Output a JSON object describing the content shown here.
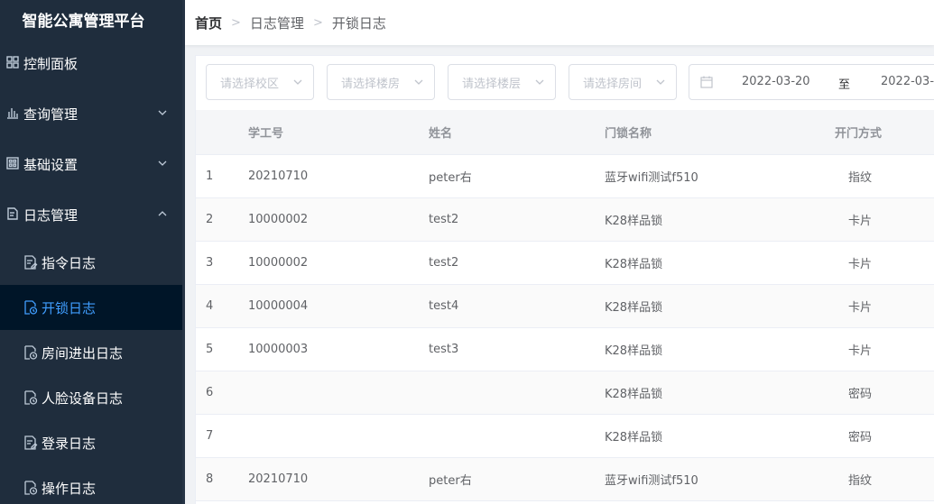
{
  "app": {
    "title": "智能公寓管理平台"
  },
  "sidebar": {
    "menus": [
      {
        "label": "控制面板",
        "icon": "dashboard-icon",
        "has_arrow": false
      },
      {
        "label": "查询管理",
        "icon": "chart-icon",
        "has_arrow": true,
        "expanded": false
      },
      {
        "label": "基础设置",
        "icon": "grid-icon",
        "has_arrow": true,
        "expanded": false
      },
      {
        "label": "日志管理",
        "icon": "log-icon",
        "has_arrow": true,
        "expanded": true
      }
    ],
    "log_submenu": [
      {
        "label": "指令日志",
        "icon": "doc-edit-icon",
        "active": false
      },
      {
        "label": "开锁日志",
        "icon": "doc-clock-icon",
        "active": true
      },
      {
        "label": "房间进出日志",
        "icon": "doc-clock-icon",
        "active": false
      },
      {
        "label": "人脸设备日志",
        "icon": "doc-clock-icon",
        "active": false
      },
      {
        "label": "登录日志",
        "icon": "doc-edit-icon",
        "active": false
      },
      {
        "label": "操作日志",
        "icon": "doc-clock-icon",
        "active": false
      }
    ]
  },
  "breadcrumb": {
    "home": "首页",
    "level1": "日志管理",
    "level2": "开锁日志"
  },
  "filters": {
    "campus_placeholder": "请选择校区",
    "building_placeholder": "请选择楼房",
    "floor_placeholder": "请选择楼层",
    "room_placeholder": "请选择房间",
    "date_start": "2022-03-20",
    "date_separator": "至",
    "date_end": "2022-03-"
  },
  "table": {
    "headers": {
      "id": "学工号",
      "name": "姓名",
      "lock": "门锁名称",
      "method": "开门方式"
    },
    "rows": [
      {
        "idx": "1",
        "id": "20210710",
        "name": "peter右",
        "lock": "蓝牙wifi测试f510",
        "method": "指纹"
      },
      {
        "idx": "2",
        "id": "10000002",
        "name": "test2",
        "lock": "K28样品锁",
        "method": "卡片"
      },
      {
        "idx": "3",
        "id": "10000002",
        "name": "test2",
        "lock": "K28样品锁",
        "method": "卡片"
      },
      {
        "idx": "4",
        "id": "10000004",
        "name": "test4",
        "lock": "K28样品锁",
        "method": "卡片"
      },
      {
        "idx": "5",
        "id": "10000003",
        "name": "test3",
        "lock": "K28样品锁",
        "method": "卡片"
      },
      {
        "idx": "6",
        "id": "",
        "name": "",
        "lock": "K28样品锁",
        "method": "密码"
      },
      {
        "idx": "7",
        "id": "",
        "name": "",
        "lock": "K28样品锁",
        "method": "密码"
      },
      {
        "idx": "8",
        "id": "20210710",
        "name": "peter右",
        "lock": "蓝牙wifi测试f510",
        "method": "指纹"
      }
    ]
  },
  "colors": {
    "sidebar_bg": "#1f2d3d",
    "active_item_bg": "#001528",
    "accent": "#409eff"
  }
}
